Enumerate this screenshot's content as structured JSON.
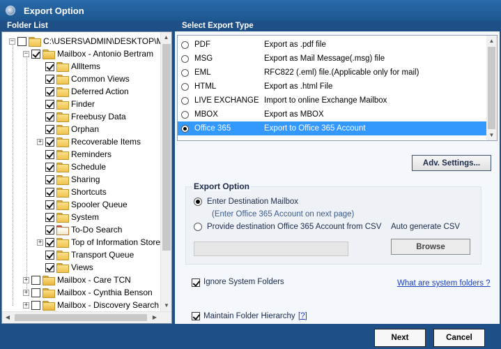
{
  "window": {
    "title": "Export Option"
  },
  "folder_list": {
    "label": "Folder List",
    "root": "C:\\USERS\\ADMIN\\DESKTOP\\MA",
    "mailbox": "Mailbox - Antonio Bertram",
    "children": [
      "Allltems",
      "Common Views",
      "Deferred Action",
      "Finder",
      "Freebusy Data",
      "Orphan",
      "Recoverable Items",
      "Reminders",
      "Schedule",
      "Sharing",
      "Shortcuts",
      "Spooler Queue",
      "System",
      "To-Do Search",
      "Top of Information Store",
      "Transport Queue",
      "Views"
    ],
    "other_mailboxes": [
      "Mailbox - Care TCN",
      "Mailbox - Cynthia Benson",
      "Mailbox - Discovery Search M"
    ]
  },
  "export_type": {
    "label": "Select Export Type",
    "options": [
      {
        "name": "PDF",
        "desc": "Export as .pdf file"
      },
      {
        "name": "MSG",
        "desc": "Export as Mail Message(.msg) file"
      },
      {
        "name": "EML",
        "desc": "RFC822 (.eml) file.(Applicable only for mail)"
      },
      {
        "name": "HTML",
        "desc": "Export as .html File"
      },
      {
        "name": "LIVE EXCHANGE",
        "desc": "Import to online Exchange Mailbox"
      },
      {
        "name": "MBOX",
        "desc": "Export as MBOX"
      },
      {
        "name": "Office 365",
        "desc": "Export to Office 365 Account"
      }
    ],
    "selected": "Office 365"
  },
  "adv_settings_label": "Adv. Settings...",
  "export_option": {
    "title": "Export Option",
    "opt1_label": "Enter Destination Mailbox",
    "opt1_hint": "(Enter Office 365 Account on next page)",
    "opt2_label": "Provide destination Office 365 Account from CSV",
    "auto_csv": "Auto generate CSV",
    "browse_label": "Browse",
    "csv_value": ""
  },
  "ignore_system_folders": "Ignore System Folders",
  "system_folders_link": "What are system folders ?",
  "maintain_hierarchy": "Maintain Folder Hierarchy",
  "help_link": "[?]",
  "next_label": "Next",
  "cancel_label": "Cancel",
  "colors": {
    "accent": "#1e4f86",
    "selection": "#3399ff"
  }
}
